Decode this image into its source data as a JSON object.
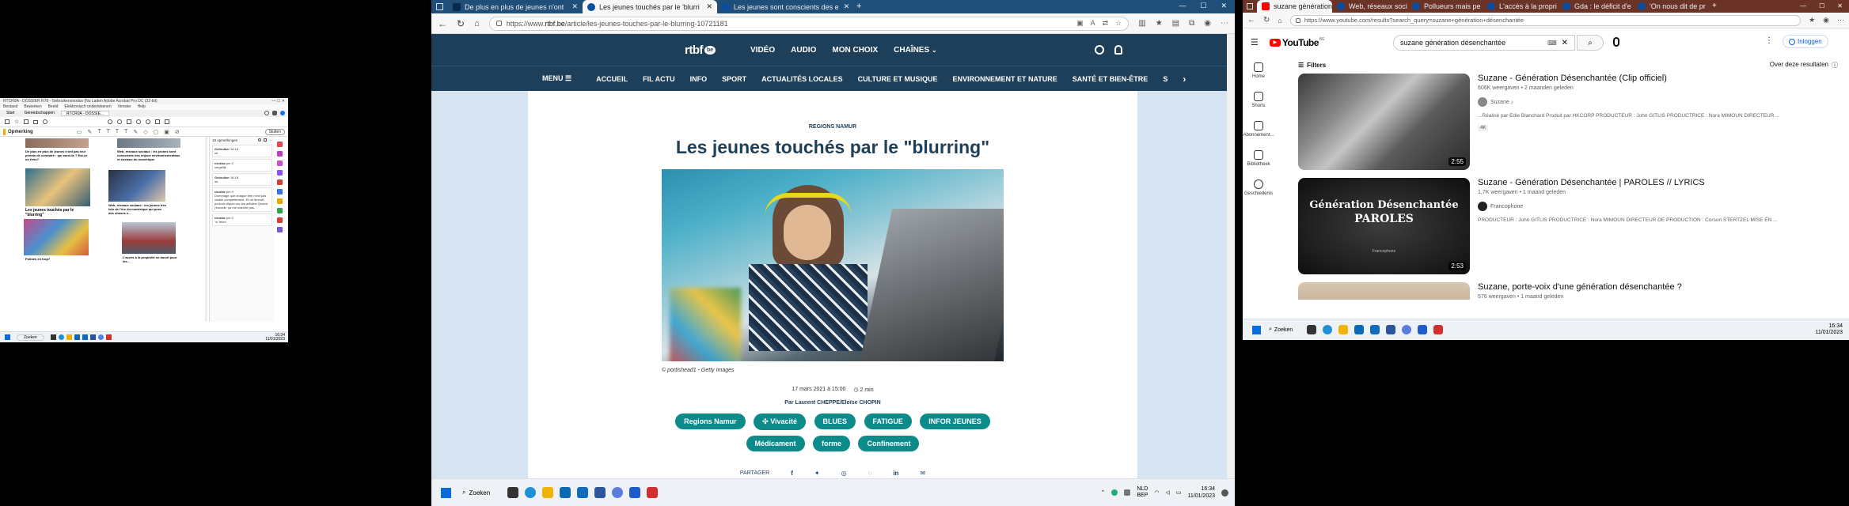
{
  "pdf": {
    "title": "RTCR0A - DOSSIER R78 - Gebruikersmodus (Nu Laden Adobe Acrobat Pro DC (32-bit)",
    "menu": [
      "Bestand",
      "Bewerken",
      "Beeld",
      "Elektronisch ondertekenen",
      "Venster",
      "Help"
    ],
    "tabs": [
      "Start",
      "Gereedschappen",
      "RTCR0A - DOSSIE..."
    ],
    "toolbar_label": "Opmerking",
    "close_label": "Sluiten",
    "comments_count": "18 opmerkingen",
    "articles": [
      {
        "title": "De plus en plus de jeunes n'ont pas leur permis de conduire : qui sont-ils ? Est-ce un frein?"
      },
      {
        "title": "Web, réseaux sociaux : les jeunes sont conscients des enjeux environnementaux et sociaux du numérique"
      },
      {
        "title": "Les jeunes touchés par le \"blurring\""
      },
      {
        "title": "Web, réseaux sociaux : les jeunes très loin de l'ère du numérique qui pose des choses e..."
      },
      {
        "title": "Pollués en trop?"
      },
      {
        "title": "L'accès à la propriété se durcit pour les..."
      }
    ],
    "comments": [
      {
        "user": "Gebruiker",
        "time": "16:18",
        "text": "ok"
      },
      {
        "user": "nicolas",
        "time": "pm 0",
        "text": "vergelijk"
      },
      {
        "user": "Gebruiker",
        "time": "16:18",
        "text": "ok"
      },
      {
        "user": "nicolas",
        "time": "pm 0",
        "text": "Dommage que chaque titre n'est pas visible complètement. Et ne devrait pouvoir cliquer sur les articles! Quand j'encode, ça me marche pas."
      },
      {
        "user": "nicolas",
        "time": "pm 0",
        "text": "'\\o 'leum"
      }
    ],
    "taskbar_time": "16:34",
    "taskbar_date": "11/01/2023",
    "search_label": "Zoeken"
  },
  "edge": {
    "tabs": [
      {
        "label": "De plus en plus de jeunes n'ont"
      },
      {
        "label": "Les jeunes touchés par le 'blurri"
      },
      {
        "label": "Les jeunes sont conscients des e"
      }
    ],
    "url_prefix": "https://www.",
    "url_host": "rtbf.be",
    "url_path": "/article/les-jeunes-touches-par-le-blurring-10721181",
    "site": {
      "logo": "rtbf",
      "logo_badge": "be",
      "top_nav": [
        "VIDÉO",
        "AUDIO",
        "MON CHOIX",
        "CHAÎNES"
      ],
      "menu_label": "MENU",
      "sub_nav": [
        "ACCUEIL",
        "FIL ACTU",
        "INFO",
        "SPORT",
        "ACTUALITÉS LOCALES",
        "CULTURE ET MUSIQUE",
        "ENVIRONNEMENT ET NATURE",
        "SANTÉ ET BIEN-ÊTRE",
        "S"
      ]
    },
    "article": {
      "kicker": "REGIONS NAMUR",
      "title": "Les jeunes touchés par le \"blurring\"",
      "caption": "© portishead1 - Getty Images",
      "date": "17 mars 2021 à 15:00",
      "read_time": "2 min",
      "author_prefix": "Par",
      "author": "Laurent CHEPPE/Eloïse CHOPIN",
      "tags": [
        "Regions Namur",
        "Vivacité",
        "BLUES",
        "FATIGUE",
        "INFOR JEUNES",
        "Médicament",
        "forme",
        "Confinement"
      ],
      "share_label": "PARTAGER"
    },
    "taskbar": {
      "search_label": "Zoeken",
      "lang": "NLD",
      "lang2": "BEP",
      "time": "16:34",
      "date": "11/01/2023"
    }
  },
  "youtube": {
    "tabs": [
      {
        "label": "suzane génération"
      },
      {
        "label": "Web, réseaux socia"
      },
      {
        "label": "Pollueurs mais pe"
      },
      {
        "label": "L'accès à la propri"
      },
      {
        "label": "Gda : le déficit d'e"
      },
      {
        "label": "'On nous dit de pr"
      }
    ],
    "url": "https://www.youtube.com/results?search_query=suzane+génération+désenchantée",
    "logo_text": "YouTube",
    "logo_sup": "BE",
    "search_value": "suzane génération désenchantée",
    "signin": "Inloggen",
    "filters": "Filters",
    "about": "Over deze resultaten",
    "sidebar": [
      "Home",
      "Shorts",
      "Abonnement...",
      "Bibliotheek",
      "Geschiedenis"
    ],
    "results": [
      {
        "title": "Suzane - Génération Désenchantée (Clip officiel)",
        "meta": "606K weergaven • 2 maanden geleden",
        "channel": "Suzane ♪",
        "desc": "...Réalisé par Edie Blanchard Produit par HKCORP PRODUCTEUR : John GITLIS PRODUCTRICE : Nora MIMOUN DIRECTEUR ...",
        "badge": "4K",
        "duration": "2:55"
      },
      {
        "title": "Suzane - Génération Désenchantée | PAROLES // LYRICS",
        "meta": "1,7K weergaven • 1 maand geleden",
        "channel": "Francophone",
        "desc": "PRODUCTEUR : John GITLIS PRODUCTRICE : Nora MIMOUN DIRECTEUR DE PRODUCTION : Corson STERTZEL MISE EN ...",
        "thumb_line1": "Génération Désenchantée",
        "thumb_line2": "PAROLES",
        "thumb_small": "Francophone",
        "duration": "2:53"
      },
      {
        "title": "Suzane, porte-voix d'une génération désenchantée ?",
        "meta": "576 weergaven • 1 maand geleden"
      }
    ],
    "taskbar": {
      "search_label": "Zoeken",
      "time": "16:34",
      "date": "11/01/2023"
    }
  }
}
